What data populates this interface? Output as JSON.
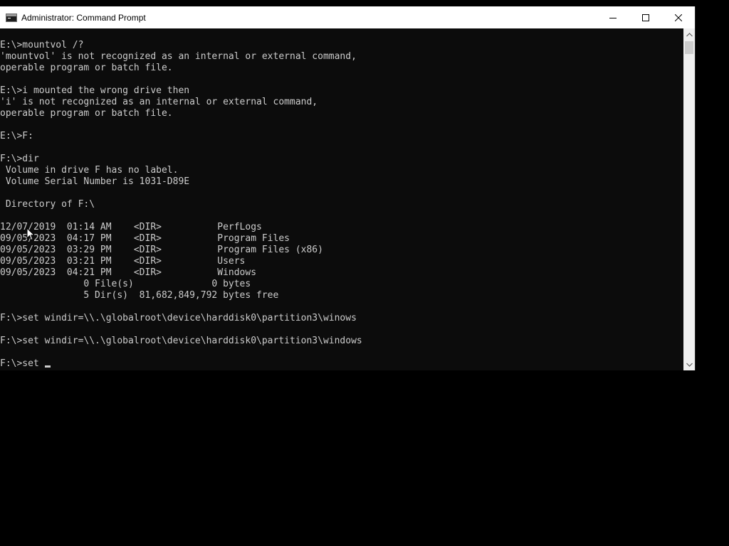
{
  "window": {
    "title": "Administrator: Command Prompt",
    "icon": "command-prompt-icon",
    "controls": {
      "minimize": "minimize-icon",
      "maximize": "maximize-icon",
      "close": "close-icon"
    }
  },
  "console": {
    "lines": [
      "E:\\>mountvol /?",
      "'mountvol' is not recognized as an internal or external command,",
      "operable program or batch file.",
      "",
      "E:\\>i mounted the wrong drive then",
      "'i' is not recognized as an internal or external command,",
      "operable program or batch file.",
      "",
      "E:\\>F:",
      "",
      "F:\\>dir",
      " Volume in drive F has no label.",
      " Volume Serial Number is 1031-D89E",
      "",
      " Directory of F:\\",
      "",
      "12/07/2019  01:14 AM    <DIR>          PerfLogs",
      "09/05/2023  04:17 PM    <DIR>          Program Files",
      "09/05/2023  03:29 PM    <DIR>          Program Files (x86)",
      "09/05/2023  03:21 PM    <DIR>          Users",
      "09/05/2023  04:21 PM    <DIR>          Windows",
      "               0 File(s)              0 bytes",
      "               5 Dir(s)  81,682,849,792 bytes free",
      "",
      "F:\\>set windir=\\\\.\\globalroot\\device\\harddisk0\\partition3\\winows",
      "",
      "F:\\>set windir=\\\\.\\globalroot\\device\\harddisk0\\partition3\\windows",
      ""
    ],
    "prompt_line": "F:\\>set "
  },
  "scrollbar": {
    "up_icon": "scroll-up-arrow-icon",
    "down_icon": "scroll-down-arrow-icon"
  },
  "colors": {
    "console_background": "#0c0c0c",
    "console_text": "#cccccc",
    "titlebar": "#ffffff",
    "desktop": "#000000"
  }
}
